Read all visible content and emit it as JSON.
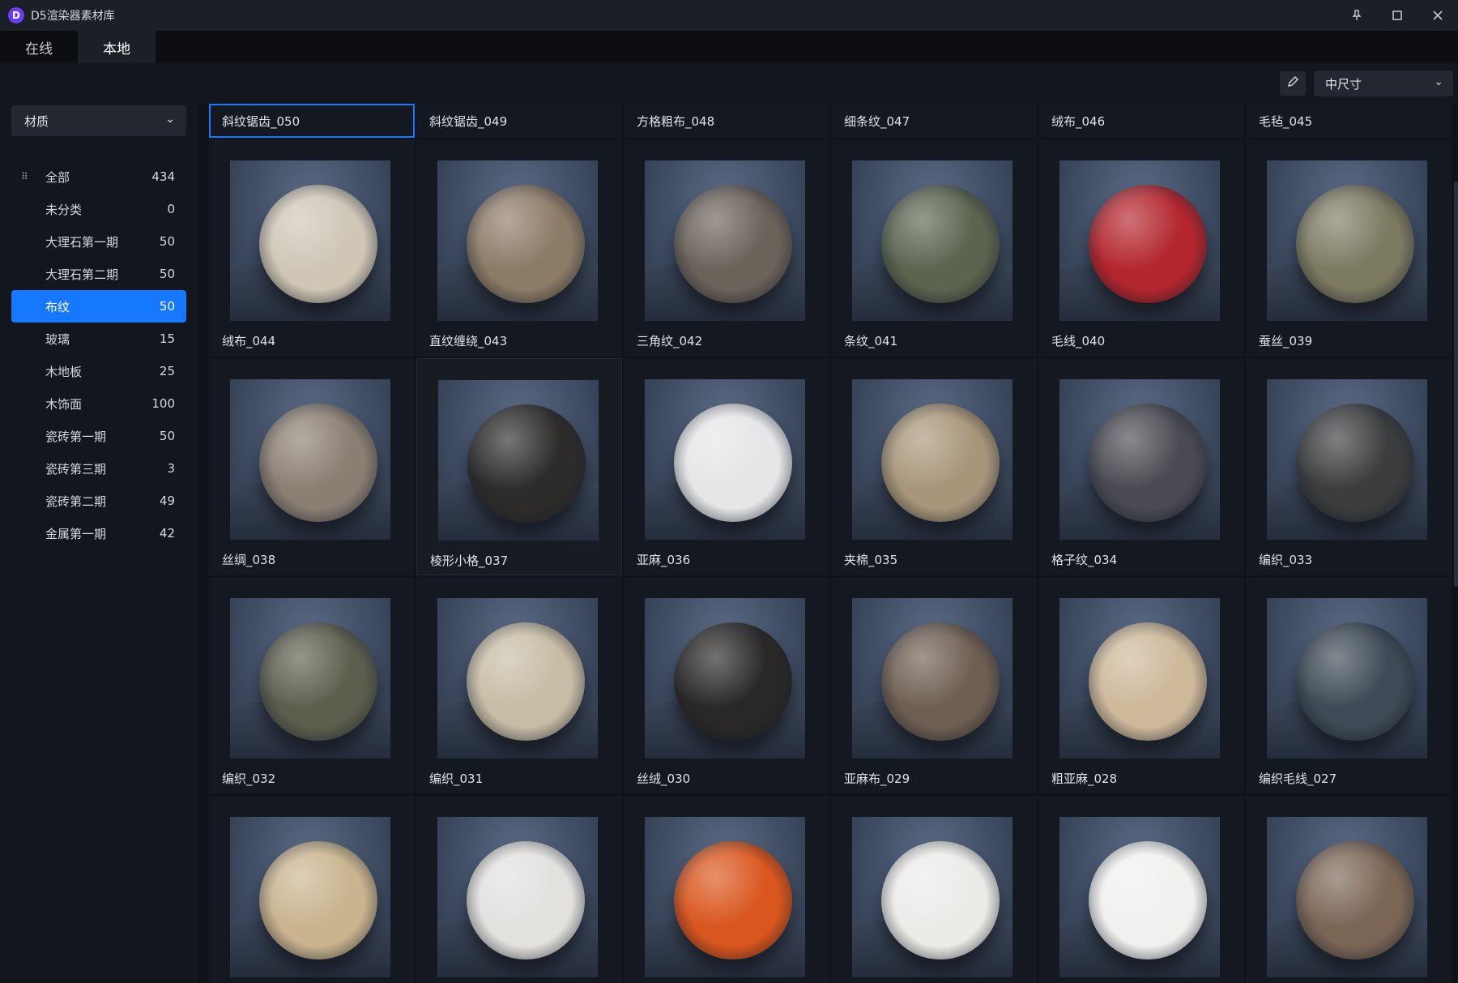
{
  "app": {
    "title": "D5渲染器素材库",
    "logo_letter": "D",
    "logo_color": "#6b3df0"
  },
  "window_controls": {
    "pin": "pin-icon",
    "maximize": "maximize-icon",
    "close": "close-icon"
  },
  "tabs": [
    {
      "label": "在线",
      "active": false
    },
    {
      "label": "本地",
      "active": true
    }
  ],
  "toolbar": {
    "size_select_value": "中尺寸"
  },
  "sidebar": {
    "category_select_value": "材质",
    "items": [
      {
        "label": "全部",
        "count": "434",
        "selected": false
      },
      {
        "label": "未分类",
        "count": "0",
        "selected": false
      },
      {
        "label": "大理石第一期",
        "count": "50",
        "selected": false
      },
      {
        "label": "大理石第二期",
        "count": "50",
        "selected": false
      },
      {
        "label": "布纹",
        "count": "50",
        "selected": true
      },
      {
        "label": "玻璃",
        "count": "15",
        "selected": false
      },
      {
        "label": "木地板",
        "count": "25",
        "selected": false
      },
      {
        "label": "木饰面",
        "count": "100",
        "selected": false
      },
      {
        "label": "瓷砖第一期",
        "count": "50",
        "selected": false
      },
      {
        "label": "瓷砖第三期",
        "count": "3",
        "selected": false
      },
      {
        "label": "瓷砖第二期",
        "count": "49",
        "selected": false
      },
      {
        "label": "金属第一期",
        "count": "42",
        "selected": false
      }
    ]
  },
  "header_row": [
    {
      "label": "斜纹锯齿_050",
      "selected": true
    },
    {
      "label": "斜纹锯齿_049",
      "selected": false
    },
    {
      "label": "方格粗布_048",
      "selected": false
    },
    {
      "label": "细条纹_047",
      "selected": false
    },
    {
      "label": "绒布_046",
      "selected": false
    },
    {
      "label": "毛毡_045",
      "selected": false
    }
  ],
  "materials": [
    {
      "label": "绒布_044",
      "color": "#cfc6b6"
    },
    {
      "label": "直纹缠绕_043",
      "color": "#8c7b67"
    },
    {
      "label": "三角纹_042",
      "color": "#6b625a"
    },
    {
      "label": "条纹_041",
      "color": "#5c6450"
    },
    {
      "label": "毛线_040",
      "color": "#b3262e"
    },
    {
      "label": "蚕丝_039",
      "color": "#7d7a62"
    },
    {
      "label": "丝绸_038",
      "color": "#8b7f73"
    },
    {
      "label": "棱形小格_037",
      "color": "#2e2c2b"
    },
    {
      "label": "亚麻_036",
      "color": "#e6e6e8"
    },
    {
      "label": "夹棉_035",
      "color": "#a8967a"
    },
    {
      "label": "格子纹_034",
      "color": "#4a4a52"
    },
    {
      "label": "编织_033",
      "color": "#3b3d3e"
    },
    {
      "label": "编织_032",
      "color": "#5d5f4e"
    },
    {
      "label": "编织_031",
      "color": "#c7bca5"
    },
    {
      "label": "丝绒_030",
      "color": "#2a2827"
    },
    {
      "label": "亚麻布_029",
      "color": "#6e5f52"
    },
    {
      "label": "粗亚麻_028",
      "color": "#cdb89a"
    },
    {
      "label": "编织毛线_027",
      "color": "#3e4a55"
    },
    {
      "label": "",
      "color": "#c9b48f"
    },
    {
      "label": "",
      "color": "#e3e1de"
    },
    {
      "label": "",
      "color": "#d9561e"
    },
    {
      "label": "",
      "color": "#ecebe8"
    },
    {
      "label": "",
      "color": "#f0f0ef"
    },
    {
      "label": "",
      "color": "#7b6656"
    }
  ]
}
